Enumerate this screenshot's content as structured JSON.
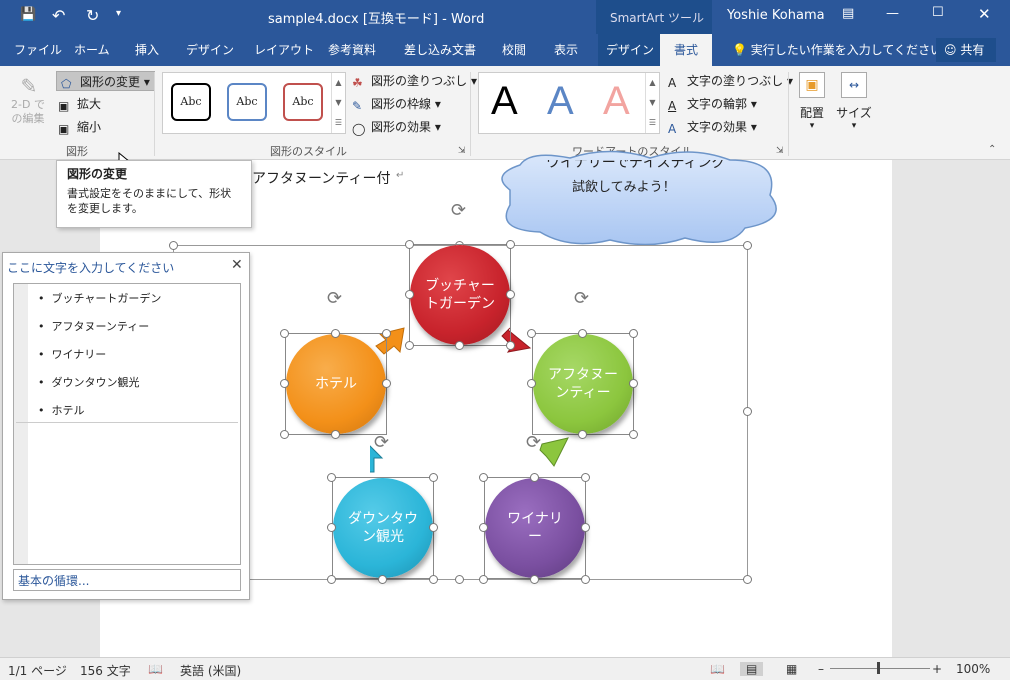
{
  "titlebar": {
    "title": "sample4.docx [互換モード] - Word",
    "context_tab": "SmartArt ツール",
    "user": "Yoshie Kohama"
  },
  "tabs": [
    "ファイル",
    "ホーム",
    "挿入",
    "デザイン",
    "レイアウト",
    "参考資料",
    "差し込み文書",
    "校閲",
    "表示",
    "デザイン",
    "書式"
  ],
  "tell_me": "実行したい作業を入力してください",
  "share": "共有",
  "ribbon": {
    "shapes": {
      "edit2d": "2-D での編集",
      "change": "図形の変更",
      "enlarge": "拡大",
      "shrink": "縮小",
      "label": "図形"
    },
    "styles": {
      "abc": "Abc",
      "fill": "図形の塗りつぶし",
      "outline": "図形の枠線",
      "effects": "図形の効果",
      "label": "図形のスタイル"
    },
    "wordart": {
      "a": "A",
      "fill": "文字の塗りつぶし",
      "outline": "文字の輪郭",
      "effects": "文字の効果",
      "label": "ワードアートのスタイル"
    },
    "arrange": "配置",
    "size": "サイズ"
  },
  "tooltip": {
    "title": "図形の変更",
    "body": "書式設定をそのままにして、形状を変更します。"
  },
  "doc": {
    "line1": "アフタヌーンティー付",
    "cloud_line1": "ワイナリーでテイスティング",
    "cloud_line2": "試飲してみよう！"
  },
  "smartart": {
    "nodes": [
      "ブッチャートガーデン",
      "アフタヌーンティー",
      "ワイナリー",
      "ダウンタウン観光",
      "ホテル"
    ],
    "colors": {
      "red": "#c8232c",
      "green": "#8cc63e",
      "purple": "#7a4fa0",
      "blue": "#2bb5d8",
      "orange": "#f39019"
    }
  },
  "textpane": {
    "title": "ここに文字を入力してください",
    "items": [
      "ブッチャートガーデン",
      "アフタヌーンティー",
      "ワイナリー",
      "ダウンタウン観光",
      "ホテル"
    ],
    "footer": "基本の循環..."
  },
  "status": {
    "page": "1/1 ページ",
    "words": "156 文字",
    "lang": "英語 (米国)",
    "zoom": "100%"
  }
}
